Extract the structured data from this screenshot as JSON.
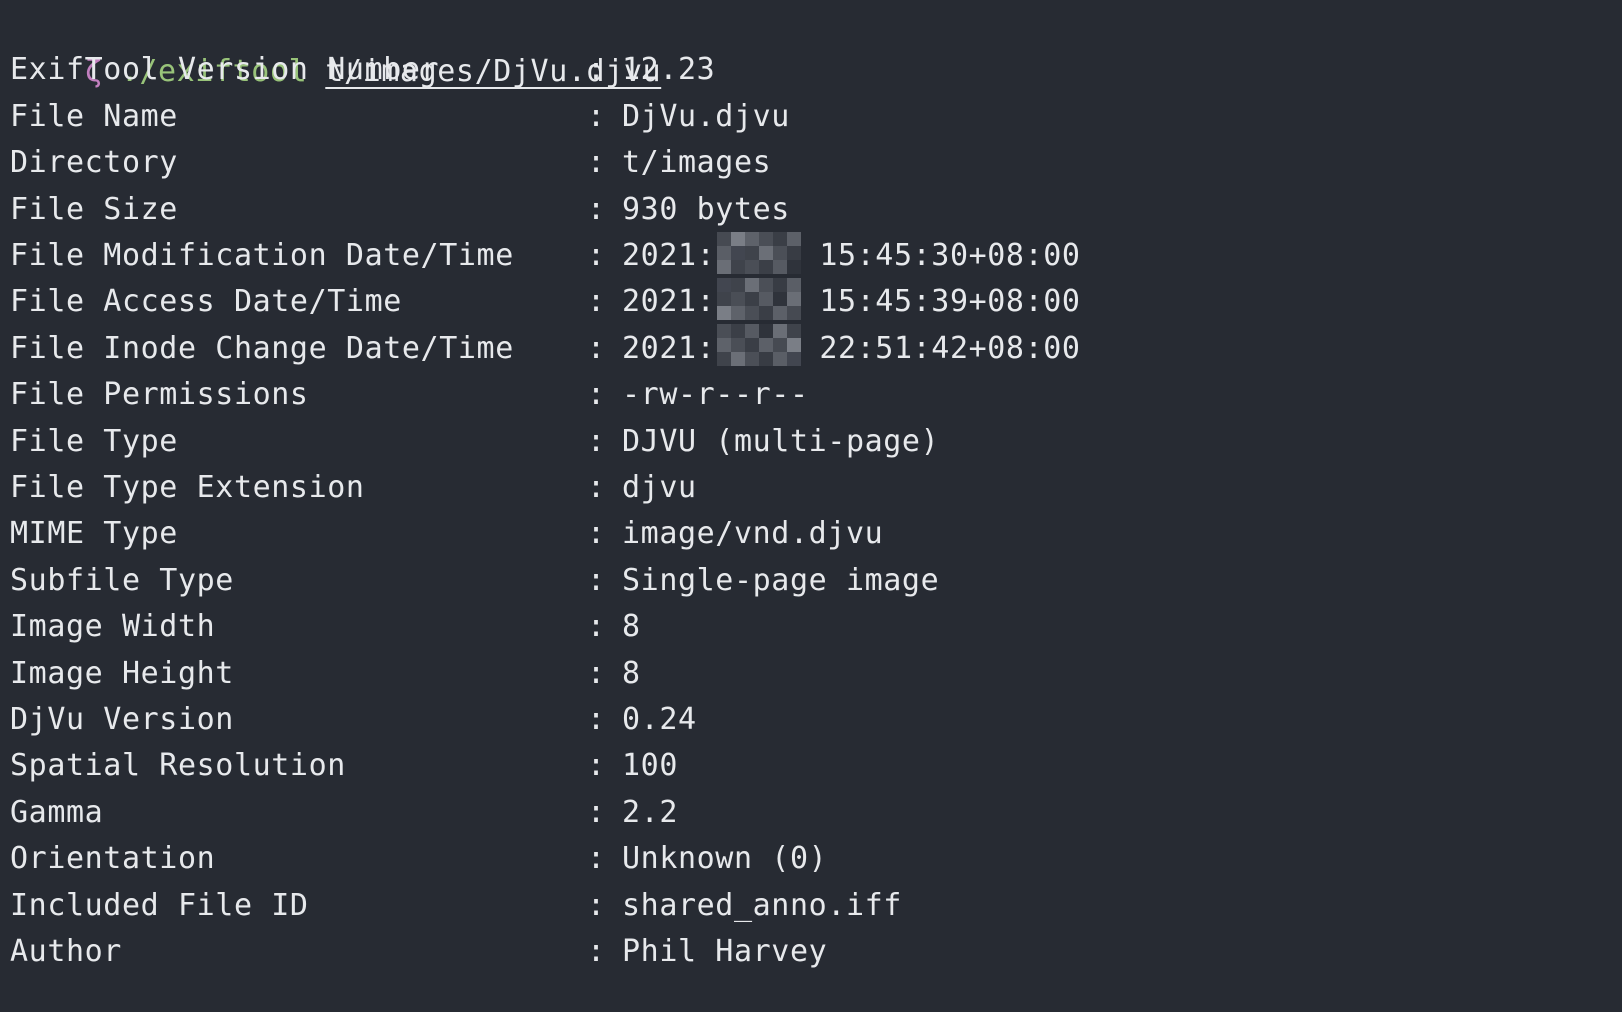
{
  "prompt": {
    "symbol": "ζ",
    "command": "./exiftool",
    "argument": "t/images/DjVu.djvu"
  },
  "separator": ":",
  "rows": [
    {
      "key": "ExifTool Version Number",
      "value": "12.23"
    },
    {
      "key": "File Name",
      "value": "DjVu.djvu"
    },
    {
      "key": "Directory",
      "value": "t/images"
    },
    {
      "key": "File Size",
      "value": "930 bytes"
    },
    {
      "key": "File Modification Date/Time",
      "value_prefix": "2021:",
      "value_suffix": "15:45:30+08:00",
      "redacted": true
    },
    {
      "key": "File Access Date/Time",
      "value_prefix": "2021:",
      "value_suffix": "15:45:39+08:00",
      "redacted": true
    },
    {
      "key": "File Inode Change Date/Time",
      "value_prefix": "2021:",
      "value_suffix": "22:51:42+08:00",
      "redacted": true
    },
    {
      "key": "File Permissions",
      "value": "-rw-r--r--"
    },
    {
      "key": "File Type",
      "value": "DJVU (multi-page)"
    },
    {
      "key": "File Type Extension",
      "value": "djvu"
    },
    {
      "key": "MIME Type",
      "value": "image/vnd.djvu"
    },
    {
      "key": "Subfile Type",
      "value": "Single-page image"
    },
    {
      "key": "Image Width",
      "value": "8"
    },
    {
      "key": "Image Height",
      "value": "8"
    },
    {
      "key": "DjVu Version",
      "value": "0.24"
    },
    {
      "key": "Spatial Resolution",
      "value": "100"
    },
    {
      "key": "Gamma",
      "value": "2.2"
    },
    {
      "key": "Orientation",
      "value": "Unknown (0)"
    },
    {
      "key": "Included File ID",
      "value": "shared_anno.iff"
    },
    {
      "key": "Author",
      "value": "Phil Harvey"
    }
  ],
  "colors": {
    "background": "#272b33",
    "text": "#e7e9ec",
    "prompt_symbol": "#c27fbf",
    "command": "#98c379"
  }
}
